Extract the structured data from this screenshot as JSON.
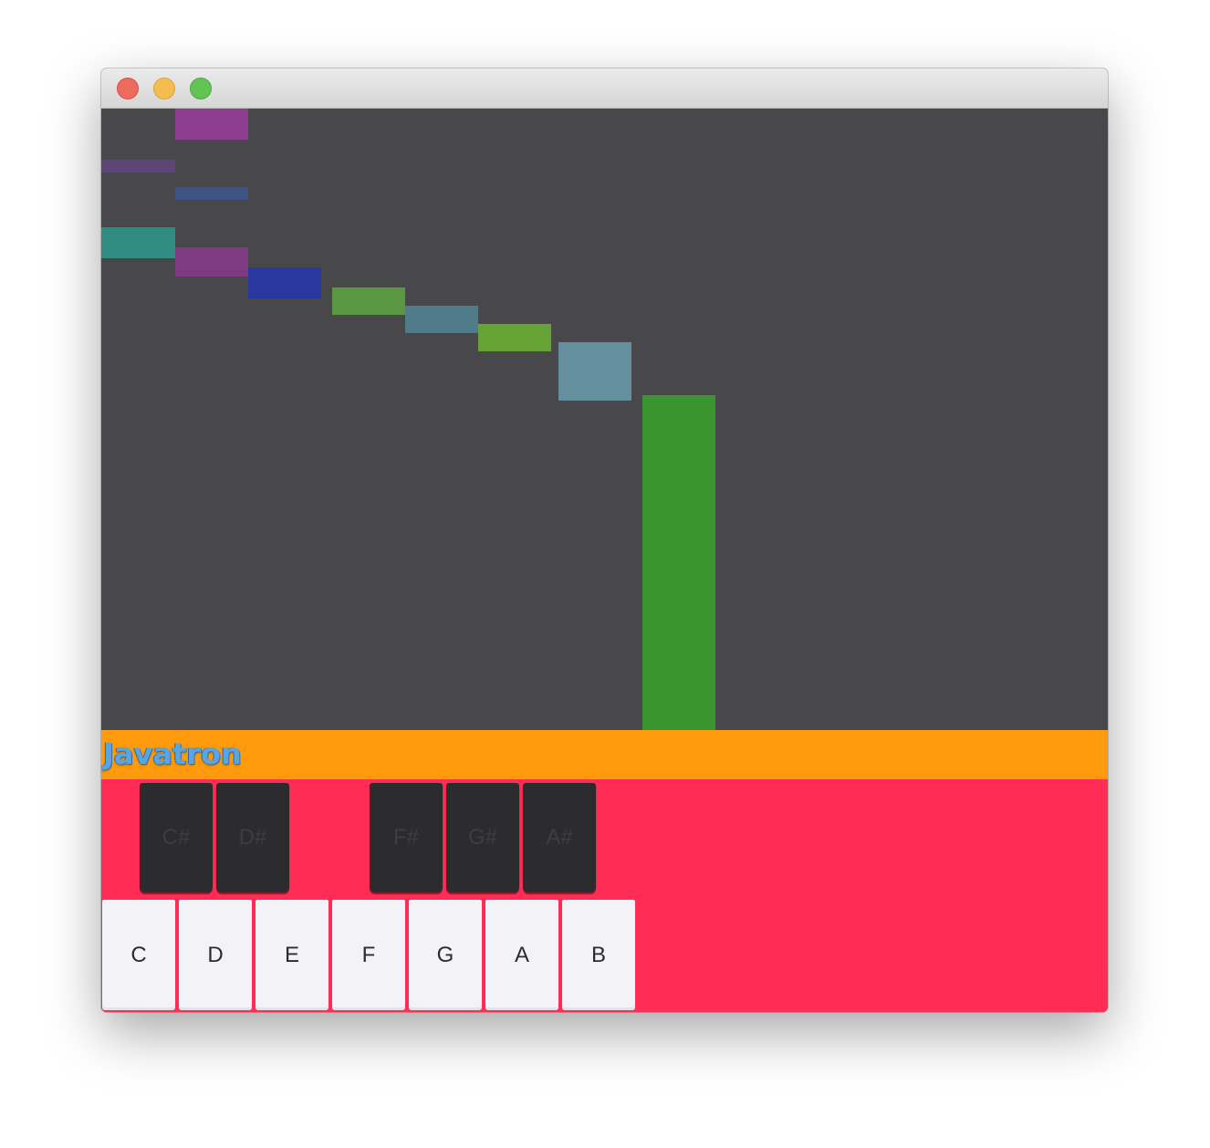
{
  "window": {
    "controls": {
      "close": "close-button",
      "minimize": "minimize-button",
      "zoom": "zoom-button"
    }
  },
  "banner": {
    "title": "Javatron"
  },
  "keyboard": {
    "black_keys": [
      "C#",
      "D#",
      "F#",
      "G#",
      "A#"
    ],
    "white_keys": [
      "C",
      "D",
      "E",
      "F",
      "G",
      "A",
      "B"
    ]
  },
  "colors": {
    "canvas": "#48484a",
    "banner": "#fe9a0b",
    "keyboard": "#ff2d55",
    "black_key": "#2c2c2e",
    "white_key": "#f2f2f7",
    "title_text": "#5aa5e0",
    "notes": [
      "#8e3e8e",
      "#5e4577",
      "#3d5484",
      "#2e8c81",
      "#7c3b83",
      "#2a379e",
      "#5a9741",
      "#4f7c88",
      "#66a334",
      "#658f9d",
      "#3a9430"
    ]
  }
}
